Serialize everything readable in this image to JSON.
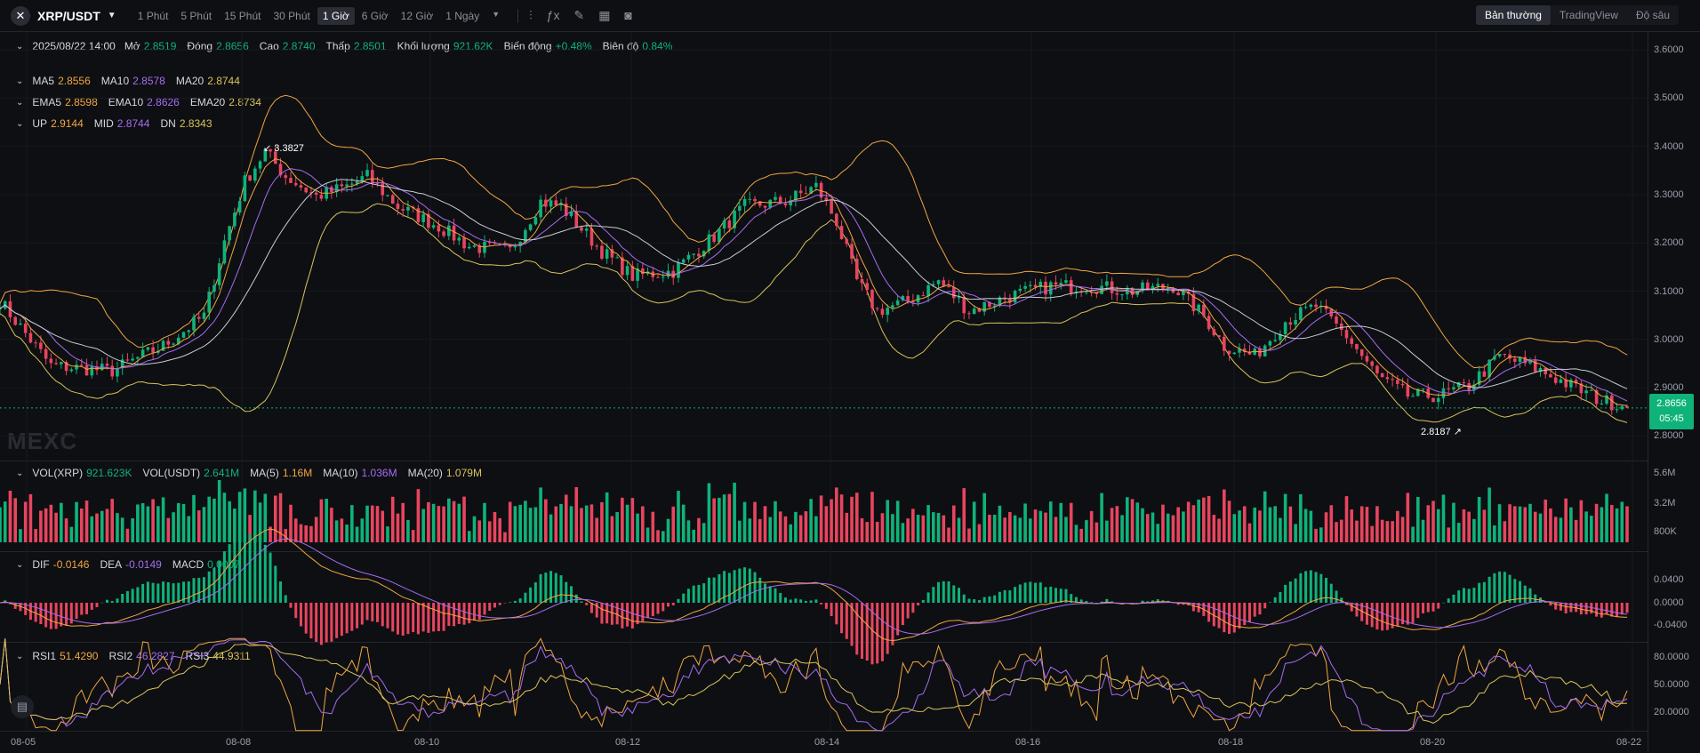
{
  "header": {
    "pair": "XRP/USDT",
    "intervals": [
      "1 Phút",
      "5 Phút",
      "15 Phút",
      "30 Phút",
      "1 Giờ",
      "6 Giờ",
      "12 Giờ",
      "1 Ngày"
    ],
    "active_interval": "1 Giờ",
    "views": [
      "Bản thường",
      "TradingView",
      "Độ sâu"
    ],
    "active_view": "Bản thường"
  },
  "ohlc": {
    "date": "2025/08/22 14:00",
    "open_label": "Mở",
    "open": "2.8519",
    "close_label": "Đóng",
    "close": "2.8656",
    "high_label": "Cao",
    "high": "2.8740",
    "low_label": "Thấp",
    "low": "2.8501",
    "volume_label": "Khối lượng",
    "volume": "921.62K",
    "change_label": "Biến động",
    "change": "+0.48%",
    "amplitude_label": "Biên độ",
    "amplitude": "0.84%"
  },
  "ma": {
    "ma5_label": "MA5",
    "ma5": "2.8556",
    "ma10_label": "MA10",
    "ma10": "2.8578",
    "ma20_label": "MA20",
    "ma20": "2.8744"
  },
  "ema": {
    "ema5_label": "EMA5",
    "ema5": "2.8598",
    "ema10_label": "EMA10",
    "ema10": "2.8626",
    "ema20_label": "EMA20",
    "ema20": "2.8734"
  },
  "boll": {
    "up_label": "UP",
    "up": "2.9144",
    "mid_label": "MID",
    "mid": "2.8744",
    "dn_label": "DN",
    "dn": "2.8343"
  },
  "annotations": {
    "high_mark": "3.3827",
    "low_mark": "2.8187"
  },
  "current_price": "2.8656",
  "countdown": "05:45",
  "price_ticks": [
    "3.6000",
    "3.5000",
    "3.4000",
    "3.3000",
    "3.2000",
    "3.1000",
    "3.0000",
    "2.9000",
    "2.8000"
  ],
  "vol": {
    "vol_xrp_label": "VOL(XRP)",
    "vol_xrp": "921.623K",
    "vol_usdt_label": "VOL(USDT)",
    "vol_usdt": "2.641M",
    "ma5_label": "MA(5)",
    "ma5": "1.16M",
    "ma10_label": "MA(10)",
    "ma10": "1.036M",
    "ma20_label": "MA(20)",
    "ma20": "1.079M"
  },
  "vol_ticks": [
    "5.6M",
    "3.2M",
    "800K"
  ],
  "macd": {
    "dif_label": "DIF",
    "dif": "-0.0146",
    "dea_label": "DEA",
    "dea": "-0.0149",
    "macd_label": "MACD",
    "macd": "0.0007"
  },
  "macd_ticks": [
    "0.0400",
    "0.0000",
    "-0.0400"
  ],
  "rsi": {
    "rsi1_label": "RSI1",
    "rsi1": "51.4290",
    "rsi2_label": "RSI2",
    "rsi2": "46.2827",
    "rsi3_label": "RSI3",
    "rsi3": "44.9311"
  },
  "rsi_ticks": [
    "80.0000",
    "50.0000",
    "20.0000"
  ],
  "dates": [
    "08-05",
    "08-08",
    "08-10",
    "08-12",
    "08-14",
    "08-16",
    "08-18",
    "08-20",
    "08-22"
  ],
  "watermark": "MEXC",
  "colors": {
    "up": "#0fb37a",
    "down": "#e8455e",
    "ma5": "#f0a640",
    "ma10": "#a46df0",
    "ma20": "#d8c35a",
    "bg": "#0e0f13"
  },
  "chart_data": {
    "type": "candlestick",
    "y_range": [
      2.76,
      3.62
    ],
    "key_prices": [
      [
        0,
        3.08
      ],
      [
        10,
        2.95
      ],
      [
        22,
        2.94
      ],
      [
        32,
        2.99
      ],
      [
        40,
        3.05
      ],
      [
        44,
        3.2
      ],
      [
        48,
        3.32
      ],
      [
        52,
        3.38
      ],
      [
        56,
        3.33
      ],
      [
        62,
        3.29
      ],
      [
        68,
        3.31
      ],
      [
        72,
        3.33
      ],
      [
        78,
        3.27
      ],
      [
        86,
        3.23
      ],
      [
        92,
        3.19
      ],
      [
        100,
        3.18
      ],
      [
        106,
        3.28
      ],
      [
        110,
        3.27
      ],
      [
        118,
        3.18
      ],
      [
        124,
        3.13
      ],
      [
        132,
        3.14
      ],
      [
        140,
        3.21
      ],
      [
        146,
        3.27
      ],
      [
        154,
        3.28
      ],
      [
        160,
        3.31
      ],
      [
        164,
        3.24
      ],
      [
        168,
        3.12
      ],
      [
        172,
        3.06
      ],
      [
        178,
        3.08
      ],
      [
        184,
        3.12
      ],
      [
        190,
        3.06
      ],
      [
        198,
        3.09
      ],
      [
        206,
        3.11
      ],
      [
        214,
        3.11
      ],
      [
        222,
        3.1
      ],
      [
        230,
        3.11
      ],
      [
        236,
        3.05
      ],
      [
        240,
        2.99
      ],
      [
        246,
        2.97
      ],
      [
        252,
        3.04
      ],
      [
        258,
        3.07
      ],
      [
        264,
        3.01
      ],
      [
        270,
        2.93
      ],
      [
        276,
        2.89
      ],
      [
        282,
        2.89
      ],
      [
        288,
        2.91
      ],
      [
        294,
        2.97
      ],
      [
        300,
        2.95
      ],
      [
        308,
        2.91
      ],
      [
        314,
        2.88
      ],
      [
        319,
        2.87
      ]
    ],
    "count": 320
  }
}
